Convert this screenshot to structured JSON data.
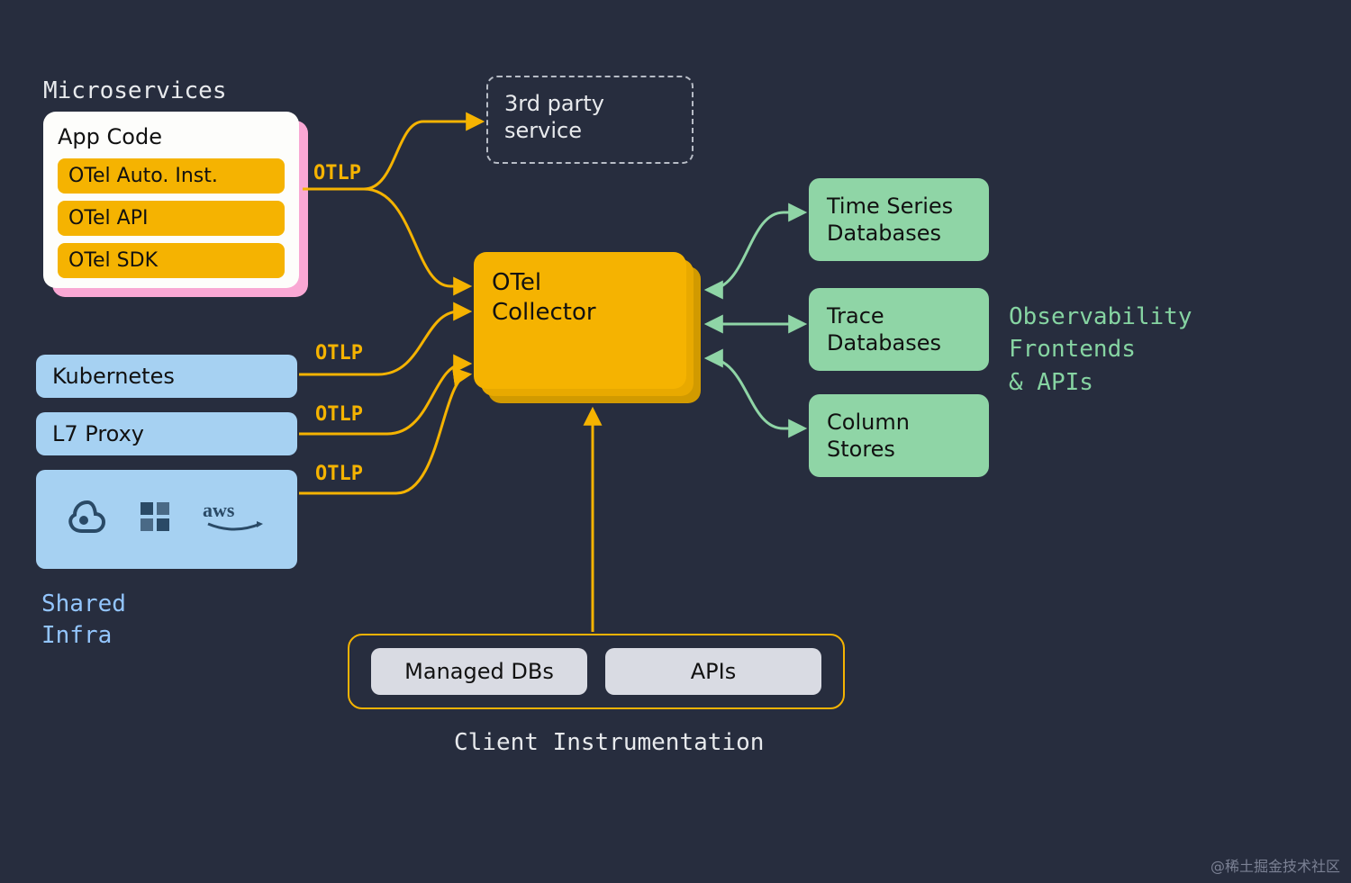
{
  "sections": {
    "microservices_title": "Microservices",
    "shared_infra_title": "Shared\nInfra",
    "observability_title": "Observability\nFrontends\n& APIs",
    "client_instrumentation_title": "Client Instrumentation"
  },
  "microservices": {
    "card_title": "App Code",
    "pills": {
      "auto_inst": "OTel Auto. Inst.",
      "api": "OTel API",
      "sdk": "OTel SDK"
    }
  },
  "shared_infra": {
    "kubernetes": "Kubernetes",
    "l7_proxy": "L7 Proxy",
    "cloud_icons": {
      "gcp": "gcp",
      "azure": "azure",
      "aws": "aws"
    }
  },
  "third_party": "3rd party service",
  "collector": "OTel\nCollector",
  "databases": {
    "time_series": "Time Series Databases",
    "trace": "Trace Databases",
    "column": "Column Stores"
  },
  "client": {
    "managed_dbs": "Managed DBs",
    "apis": "APIs"
  },
  "edge_labels": {
    "otlp1": "OTLP",
    "otlp2": "OTLP",
    "otlp3": "OTLP",
    "otlp4": "OTLP"
  },
  "colors": {
    "bg": "#272d3e",
    "yellow": "#f5b301",
    "blue": "#a6d1f2",
    "green": "#8fd5a6",
    "pink": "#f9a8d4"
  },
  "watermark": "@稀土掘金技术社区"
}
